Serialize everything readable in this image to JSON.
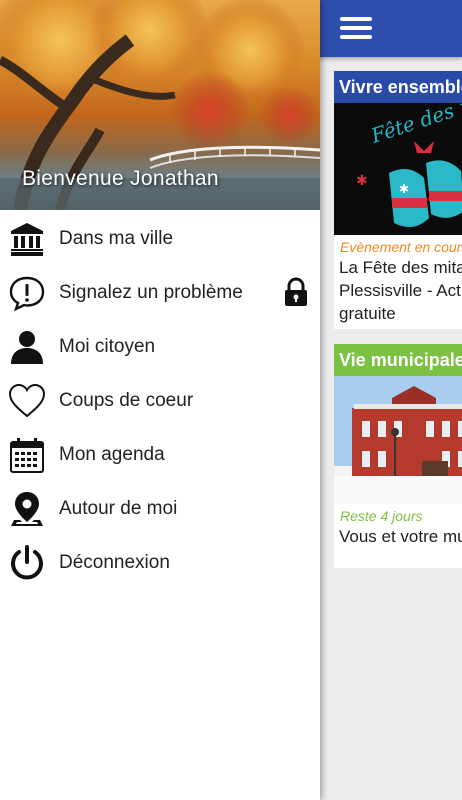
{
  "drawer": {
    "welcome": "Bienvenue Jonathan",
    "items": [
      {
        "label": "Dans ma ville",
        "icon": "city-hall-icon"
      },
      {
        "label": "Signalez un problème",
        "icon": "alert-bubble-icon"
      },
      {
        "label": "Moi citoyen",
        "icon": "person-icon"
      },
      {
        "label": "Coups de coeur",
        "icon": "heart-icon"
      },
      {
        "label": "Mon agenda",
        "icon": "calendar-icon"
      },
      {
        "label": "Autour de moi",
        "icon": "location-pin-icon"
      },
      {
        "label": "Déconnexion",
        "icon": "power-icon"
      }
    ],
    "locked_item_icon": "lock-icon"
  },
  "appbar": {
    "menu_icon": "hamburger-menu-icon",
    "color": "#2f4fae"
  },
  "cards": [
    {
      "header": "Vivre ensemble",
      "header_color": "#2a4aa8",
      "image_text": "Fête des mitaines",
      "tag": "Evènement en cours",
      "tag_color": "#f08a1e",
      "text_lines": [
        "La Fête des mitaines",
        "Plessisville - Activité",
        "gratuite"
      ]
    },
    {
      "header": "Vie municipale",
      "header_color": "#7cc142",
      "tag": "Reste 4 jours",
      "tag_color": "#7cc142",
      "text_lines": [
        "Vous et votre municipalité"
      ]
    }
  ]
}
